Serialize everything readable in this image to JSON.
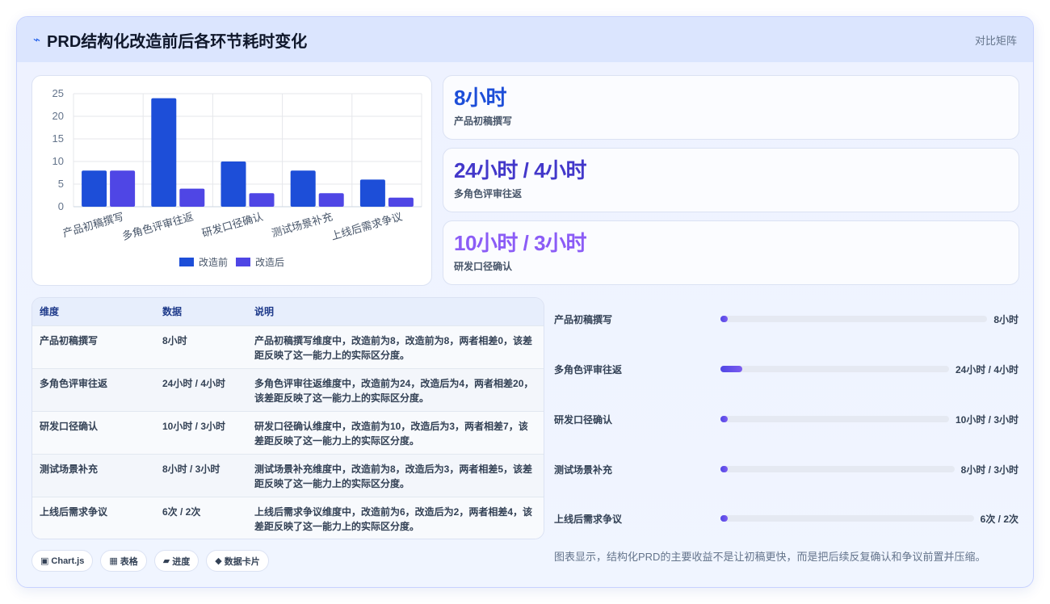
{
  "header": {
    "logo_icon": "pulse-icon",
    "title": "PRD结构化改造前后各环节耗时变化",
    "right_label": "对比矩阵"
  },
  "colors": {
    "before": "#1d4ed8",
    "after": "#4f46e5",
    "stat1": "#1d4ed8",
    "stat2": "#4338ca",
    "stat3": "#8b5cf6"
  },
  "chart_data": {
    "type": "bar",
    "categories": [
      "产品初稿撰写",
      "多角色评审往返",
      "研发口径确认",
      "测试场景补充",
      "上线后需求争议"
    ],
    "series": [
      {
        "name": "改造前",
        "values": [
          8,
          24,
          10,
          8,
          6
        ]
      },
      {
        "name": "改造后",
        "values": [
          8,
          4,
          3,
          3,
          2
        ]
      }
    ],
    "ylim": [
      0,
      25
    ],
    "yticks": [
      "0",
      "5",
      "10",
      "15",
      "20",
      "25"
    ],
    "grid": true,
    "legend": "bottom"
  },
  "stats": [
    {
      "value": "8小时",
      "label": "产品初稿撰写"
    },
    {
      "value": "24小时 / 4小时",
      "label": "多角色评审往返"
    },
    {
      "value": "10小时 / 3小时",
      "label": "研发口径确认"
    }
  ],
  "table": {
    "headers": [
      "维度",
      "数据",
      "说明"
    ],
    "rows": [
      [
        "产品初稿撰写",
        "8小时",
        "产品初稿撰写维度中，改造前为8，改造前为8，两者相差0，该差距反映了这一能力上的实际区分度。"
      ],
      [
        "多角色评审往返",
        "24小时 / 4小时",
        "多角色评审往返维度中，改造前为24，改造后为4，两者相差20，该差距反映了这一能力上的实际区分度。"
      ],
      [
        "研发口径确认",
        "10小时 / 3小时",
        "研发口径确认维度中，改造前为10，改造后为3，两者相差7，该差距反映了这一能力上的实际区分度。"
      ],
      [
        "测试场景补充",
        "8小时 / 3小时",
        "测试场景补充维度中，改造前为8，改造后为3，两者相差5，该差距反映了这一能力上的实际区分度。"
      ],
      [
        "上线后需求争议",
        "6次 / 2次",
        "上线后需求争议维度中，改造前为6，改造后为2，两者相差4，该差距反映了这一能力上的实际区分度。"
      ]
    ]
  },
  "progress": [
    {
      "label": "产品初稿撰写",
      "value": "8小时",
      "fraction": 0.0
    },
    {
      "label": "多角色评审往返",
      "value": "24小时 / 4小时",
      "fraction": 0.095
    },
    {
      "label": "研发口径确认",
      "value": "10小时 / 3小时",
      "fraction": 0.0
    },
    {
      "label": "测试场景补充",
      "value": "8小时 / 3小时",
      "fraction": 0.0
    },
    {
      "label": "上线后需求争议",
      "value": "6次 / 2次",
      "fraction": 0.0
    }
  ],
  "chips": [
    {
      "icon": "▣",
      "label": "Chart.js"
    },
    {
      "icon": "▦",
      "label": "表格"
    },
    {
      "icon": "▰",
      "label": "进度"
    },
    {
      "icon": "◆",
      "label": "数据卡片"
    }
  ],
  "footnote": "图表显示，结构化PRD的主要收益不是让初稿更快，而是把后续反复确认和争议前置并压缩。"
}
